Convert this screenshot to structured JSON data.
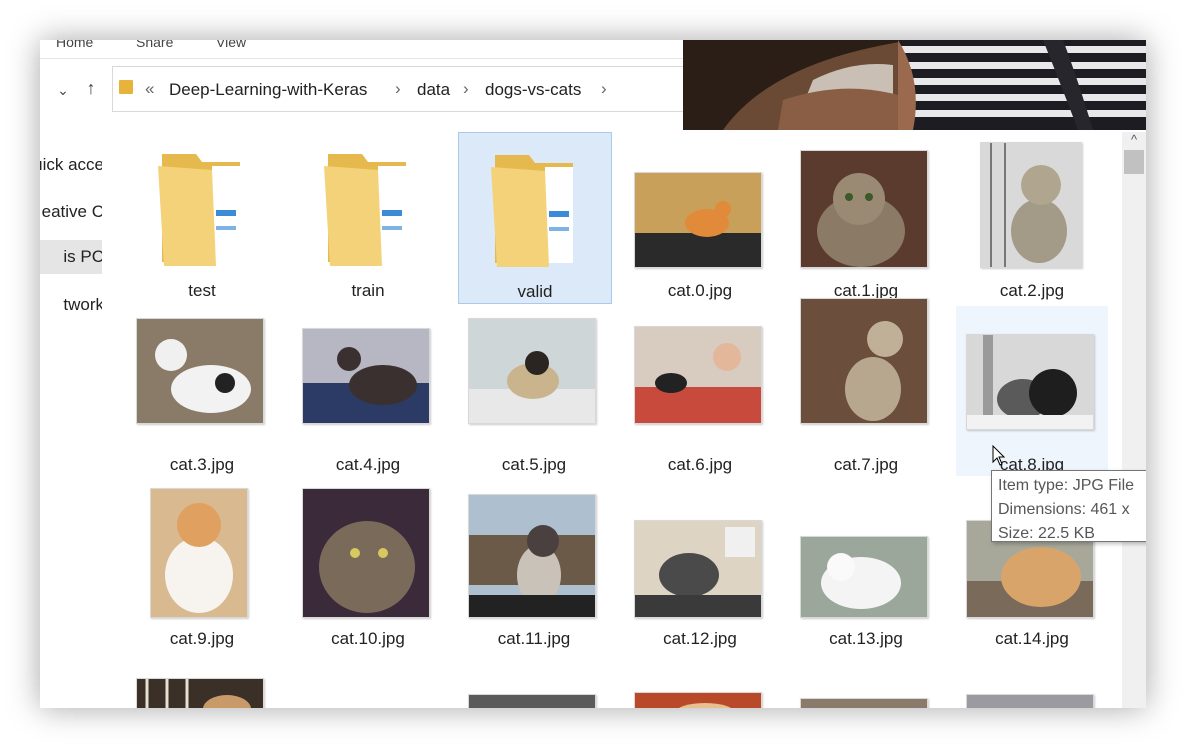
{
  "ribbon": {
    "tabs": [
      "Home",
      "Share",
      "View"
    ]
  },
  "nav": {
    "down_icon": "chevron-down",
    "up_icon": "up-arrow"
  },
  "address": {
    "overflow": "«",
    "crumbs": [
      "Deep-Learning-with-Keras",
      "data",
      "dogs-vs-cats"
    ],
    "separator": "›"
  },
  "sidebar": {
    "items": [
      "uick acce",
      "eative C",
      "is PC",
      "twork"
    ],
    "selected": 2
  },
  "scrollbar": {
    "up_arrow": "^"
  },
  "files": [
    {
      "name": "test",
      "kind": "folder"
    },
    {
      "name": "train",
      "kind": "folder"
    },
    {
      "name": "valid",
      "kind": "folder",
      "selected": true
    },
    {
      "name": "cat.0.jpg",
      "kind": "image"
    },
    {
      "name": "cat.1.jpg",
      "kind": "image"
    },
    {
      "name": "cat.2.jpg",
      "kind": "image"
    },
    {
      "name": "cat.3.jpg",
      "kind": "image"
    },
    {
      "name": "cat.4.jpg",
      "kind": "image"
    },
    {
      "name": "cat.5.jpg",
      "kind": "image"
    },
    {
      "name": "cat.6.jpg",
      "kind": "image"
    },
    {
      "name": "cat.7.jpg",
      "kind": "image"
    },
    {
      "name": "cat.8.jpg",
      "kind": "image",
      "hovered": true
    },
    {
      "name": "cat.9.jpg",
      "kind": "image"
    },
    {
      "name": "cat.10.jpg",
      "kind": "image"
    },
    {
      "name": "cat.11.jpg",
      "kind": "image"
    },
    {
      "name": "cat.12.jpg",
      "kind": "image"
    },
    {
      "name": "cat.13.jpg",
      "kind": "image"
    },
    {
      "name": "cat.14.jpg",
      "kind": "image"
    }
  ],
  "tooltip": {
    "type": "Item type: JPG File",
    "dimensions": "Dimensions: 461 x",
    "size": "Size: 22.5 KB"
  },
  "colors": {
    "folder": "#f2cd6b",
    "selection": "#dbe9f8",
    "accent": "#3c8bd6"
  }
}
